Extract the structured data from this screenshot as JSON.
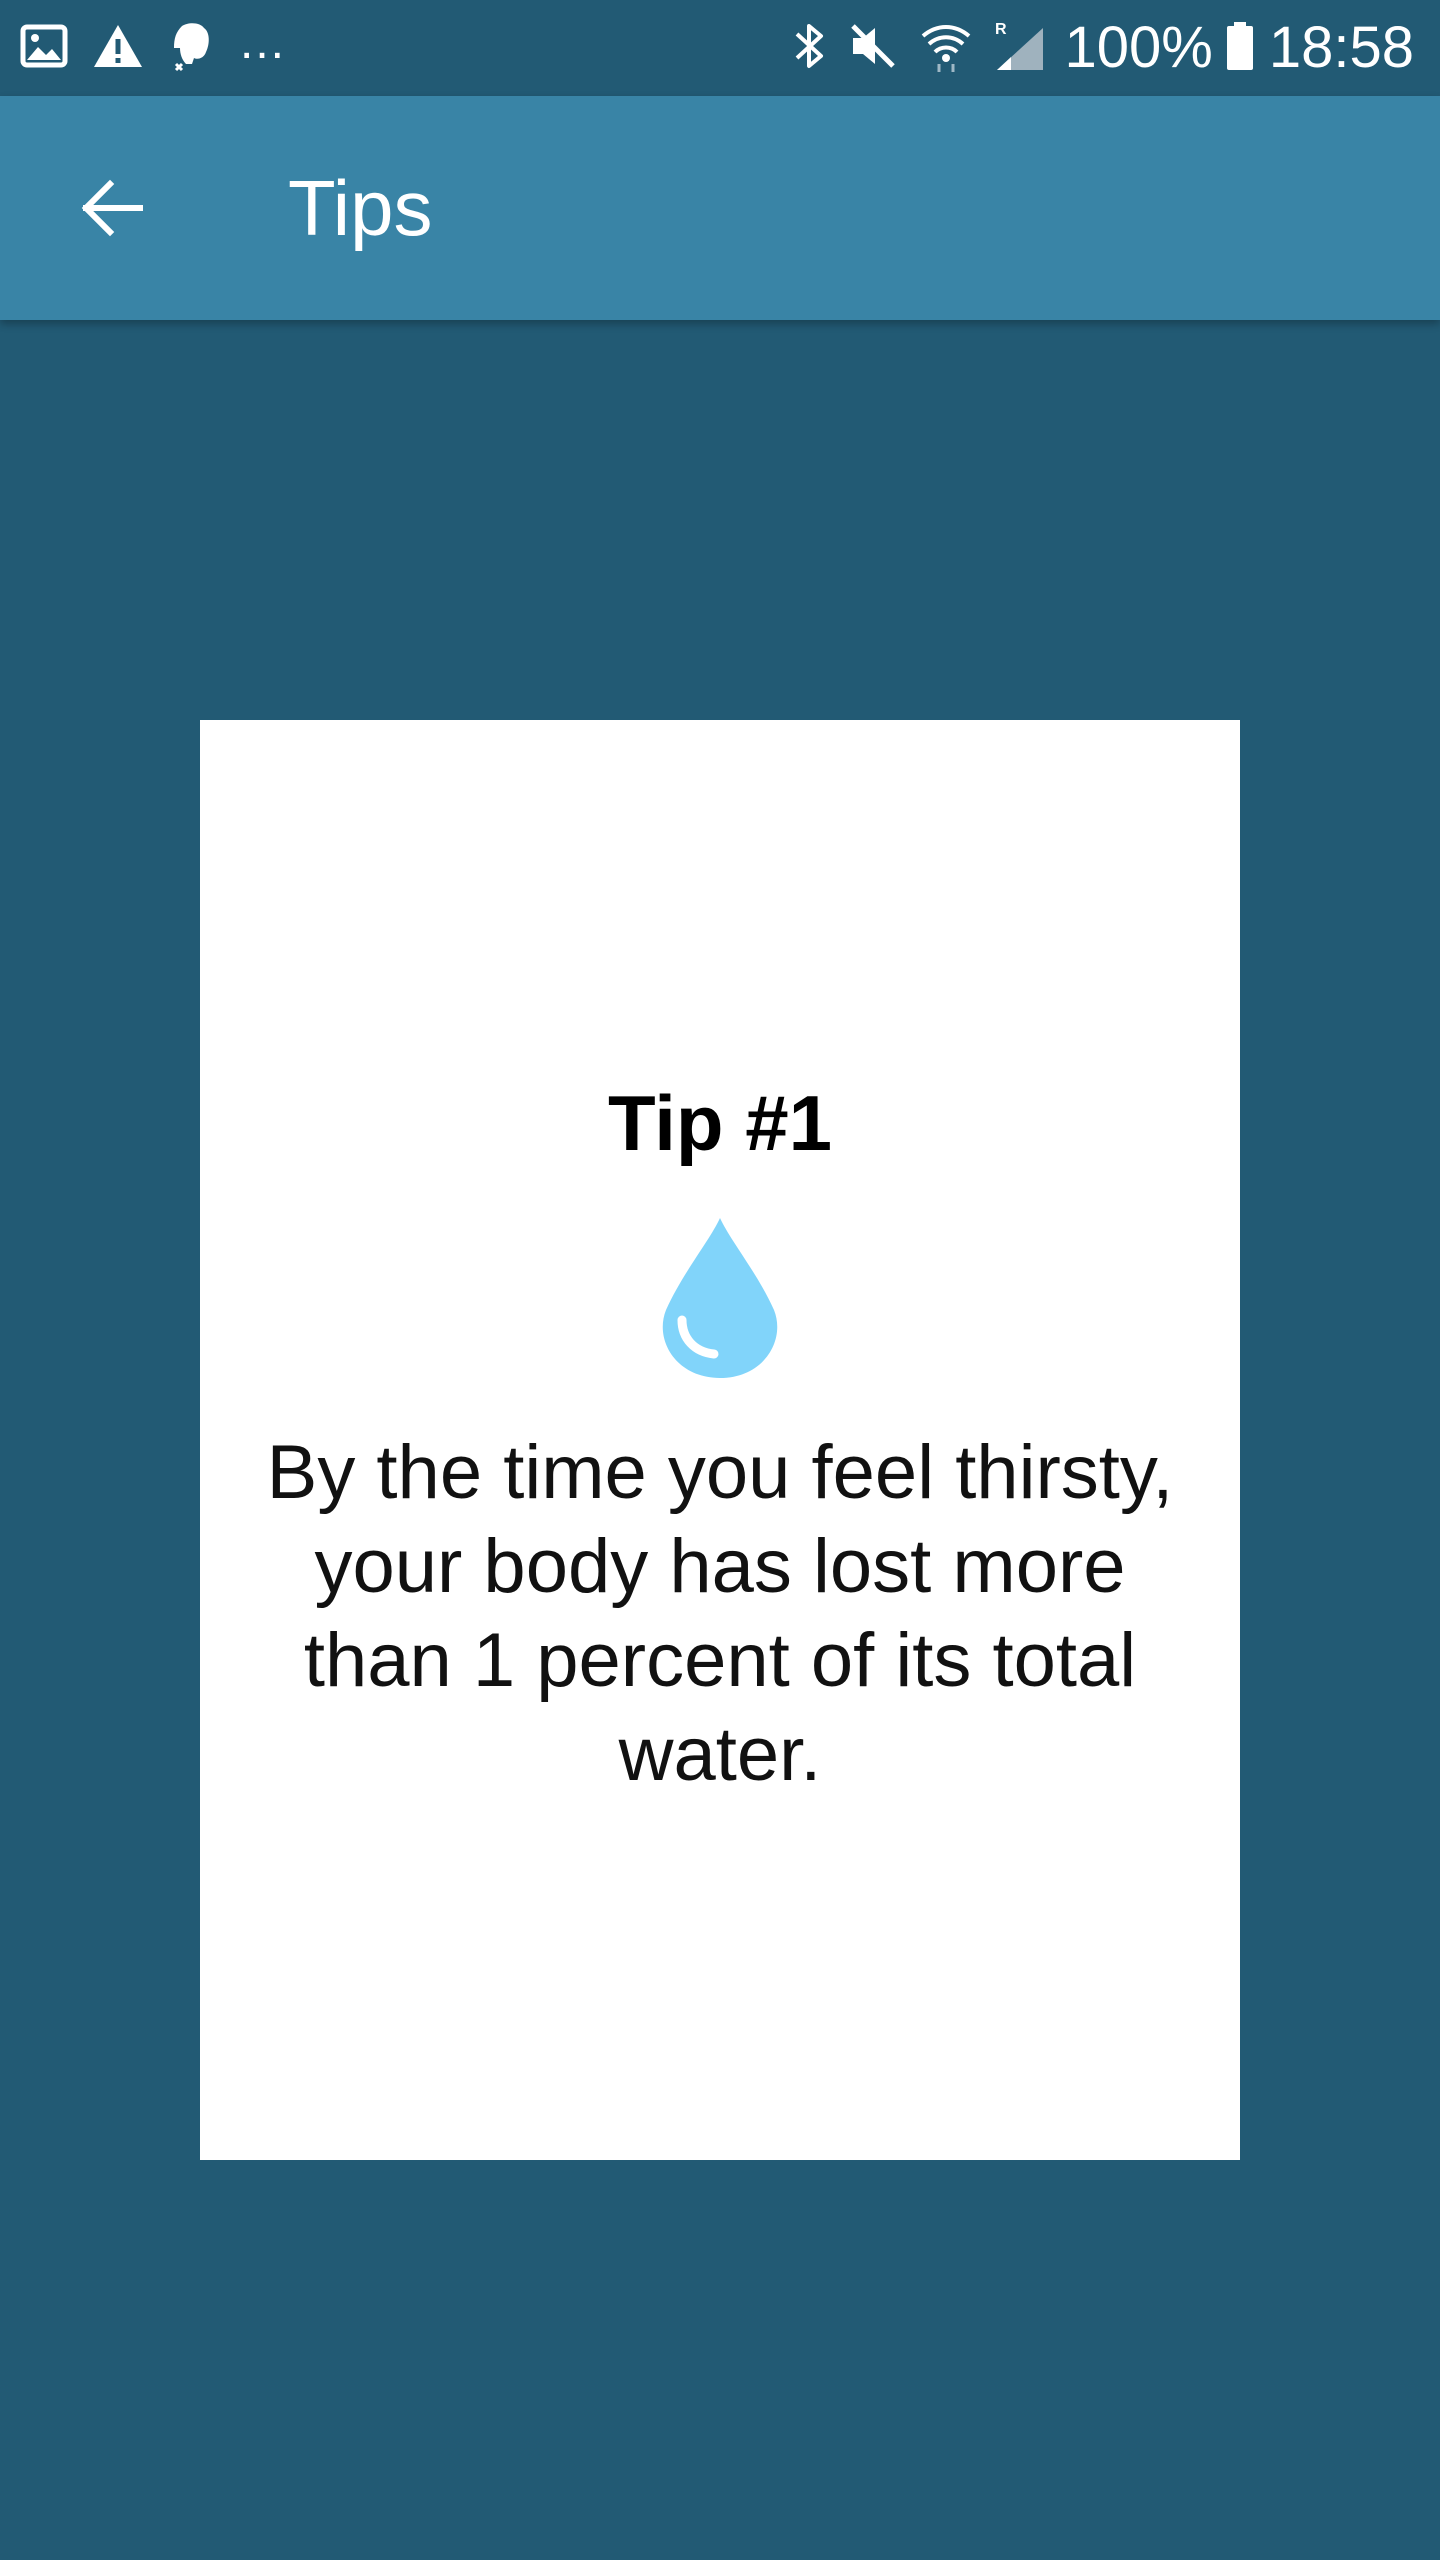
{
  "status_bar": {
    "more_indicator": "...",
    "battery_percent": "100%",
    "time": "18:58",
    "left_icons": [
      "image-icon",
      "warning-icon",
      "evernote-icon"
    ],
    "right_icons": [
      "bluetooth-icon",
      "mute-icon",
      "wifi-icon",
      "signal-icon",
      "battery-icon"
    ]
  },
  "toolbar": {
    "back_icon": "arrow-left-icon",
    "title": "Tips"
  },
  "tip": {
    "title": "Tip #1",
    "icon": "water-drop-icon",
    "text": "By the time you feel thirsty, your body has lost more than 1 percent of its total water."
  },
  "colors": {
    "background": "#225a74",
    "toolbar": "#3984a6",
    "card": "#ffffff",
    "drop": "#81d4fa"
  }
}
